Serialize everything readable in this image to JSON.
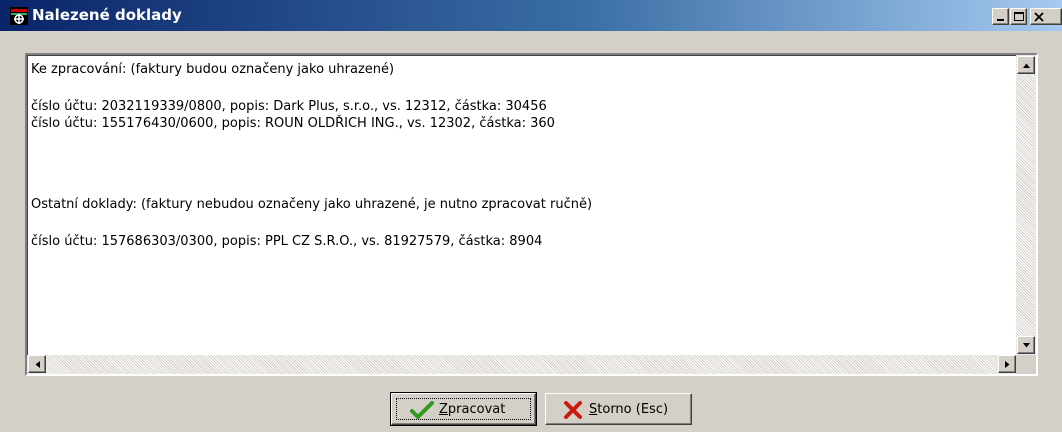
{
  "window": {
    "title": "Nalezené doklady",
    "icons": {
      "app": "app-icon",
      "minimize": "minimize-icon",
      "maximize": "maximize-icon",
      "close": "close-icon"
    }
  },
  "content": {
    "heading1": "Ke zpracování: (faktury budou označeny jako uhrazené)",
    "lines1": [
      "číslo účtu: 2032119339/0800, popis: Dark Plus, s.r.o., vs. 12312, částka: 30456",
      "číslo účtu: 155176430/0600, popis: ROUN OLDŘICH ING., vs. 12302, částka: 360"
    ],
    "heading2": "Ostatní doklady: (faktury nebudou označeny jako uhrazené, je nutno zpracovat ručně)",
    "lines2": [
      "číslo účtu: 157686303/0300, popis: PPL CZ S.R.O., vs. 81927579, částka: 8904"
    ]
  },
  "buttons": {
    "process": {
      "accel": "Z",
      "rest": "pracovat",
      "icon": "checkmark-icon",
      "color": "#2e9a1e"
    },
    "cancel": {
      "accel": "S",
      "rest": "torno (Esc)",
      "icon": "cross-icon",
      "color": "#cc1b0b"
    }
  }
}
